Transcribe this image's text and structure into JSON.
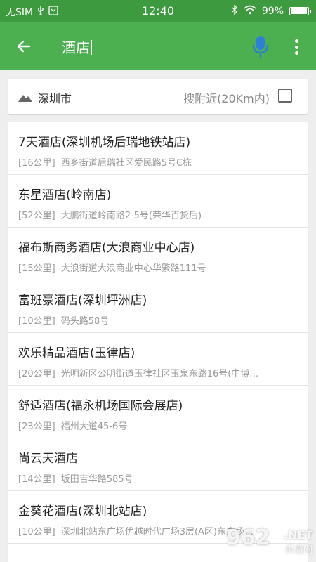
{
  "status_bar": {
    "carrier": "无SIM",
    "time": "12:40",
    "battery": "99%",
    "battery_level": 0.99,
    "icons": [
      "usb-icon",
      "debug-icon",
      "bluetooth-icon",
      "wifi-icon",
      "battery-icon"
    ]
  },
  "app_bar": {
    "search_query": "酒店",
    "colors": {
      "appbar": "#4caf50",
      "statusbar": "#3e9a3f",
      "mic": "#2d7fd8"
    }
  },
  "filter": {
    "city": "深圳市",
    "nearby_label": "搜附近(20Km内)",
    "nearby_checked": false
  },
  "results": [
    {
      "name": "7天酒店(深圳机场后瑞地铁站店)",
      "distance": "[16公里]",
      "address": "西乡街道后瑞社区爱民路5号C栋"
    },
    {
      "name": "东星酒店(岭南店)",
      "distance": "[52公里]",
      "address": "大鹏街道岭南路2-5号(荣华百货后)"
    },
    {
      "name": "福布斯商务酒店(大浪商业中心店)",
      "distance": "[15公里]",
      "address": "大浪街道大浪商业中心华繁路111号"
    },
    {
      "name": "富班豪酒店(深圳坪洲店)",
      "distance": "[10公里]",
      "address": "码头路58号"
    },
    {
      "name": "欢乐精品酒店(玉律店)",
      "distance": "[20公里]",
      "address": "光明新区公明街道玉律社区玉泉东路16号(中博…"
    },
    {
      "name": "舒适酒店(福永机场国际会展店)",
      "distance": "[23公里]",
      "address": "福州大道45-6号"
    },
    {
      "name": "尚云天酒店",
      "distance": "[14公里]",
      "address": "坂田吉华路585号"
    },
    {
      "name": "金葵花酒店(深圳北站店)",
      "distance": "[10公里]",
      "address": "深圳北站东广场优越时代广场3层(A区)东广场…"
    }
  ],
  "watermark": {
    "number": "962",
    "net": ".NET",
    "sub": "乐游网"
  }
}
